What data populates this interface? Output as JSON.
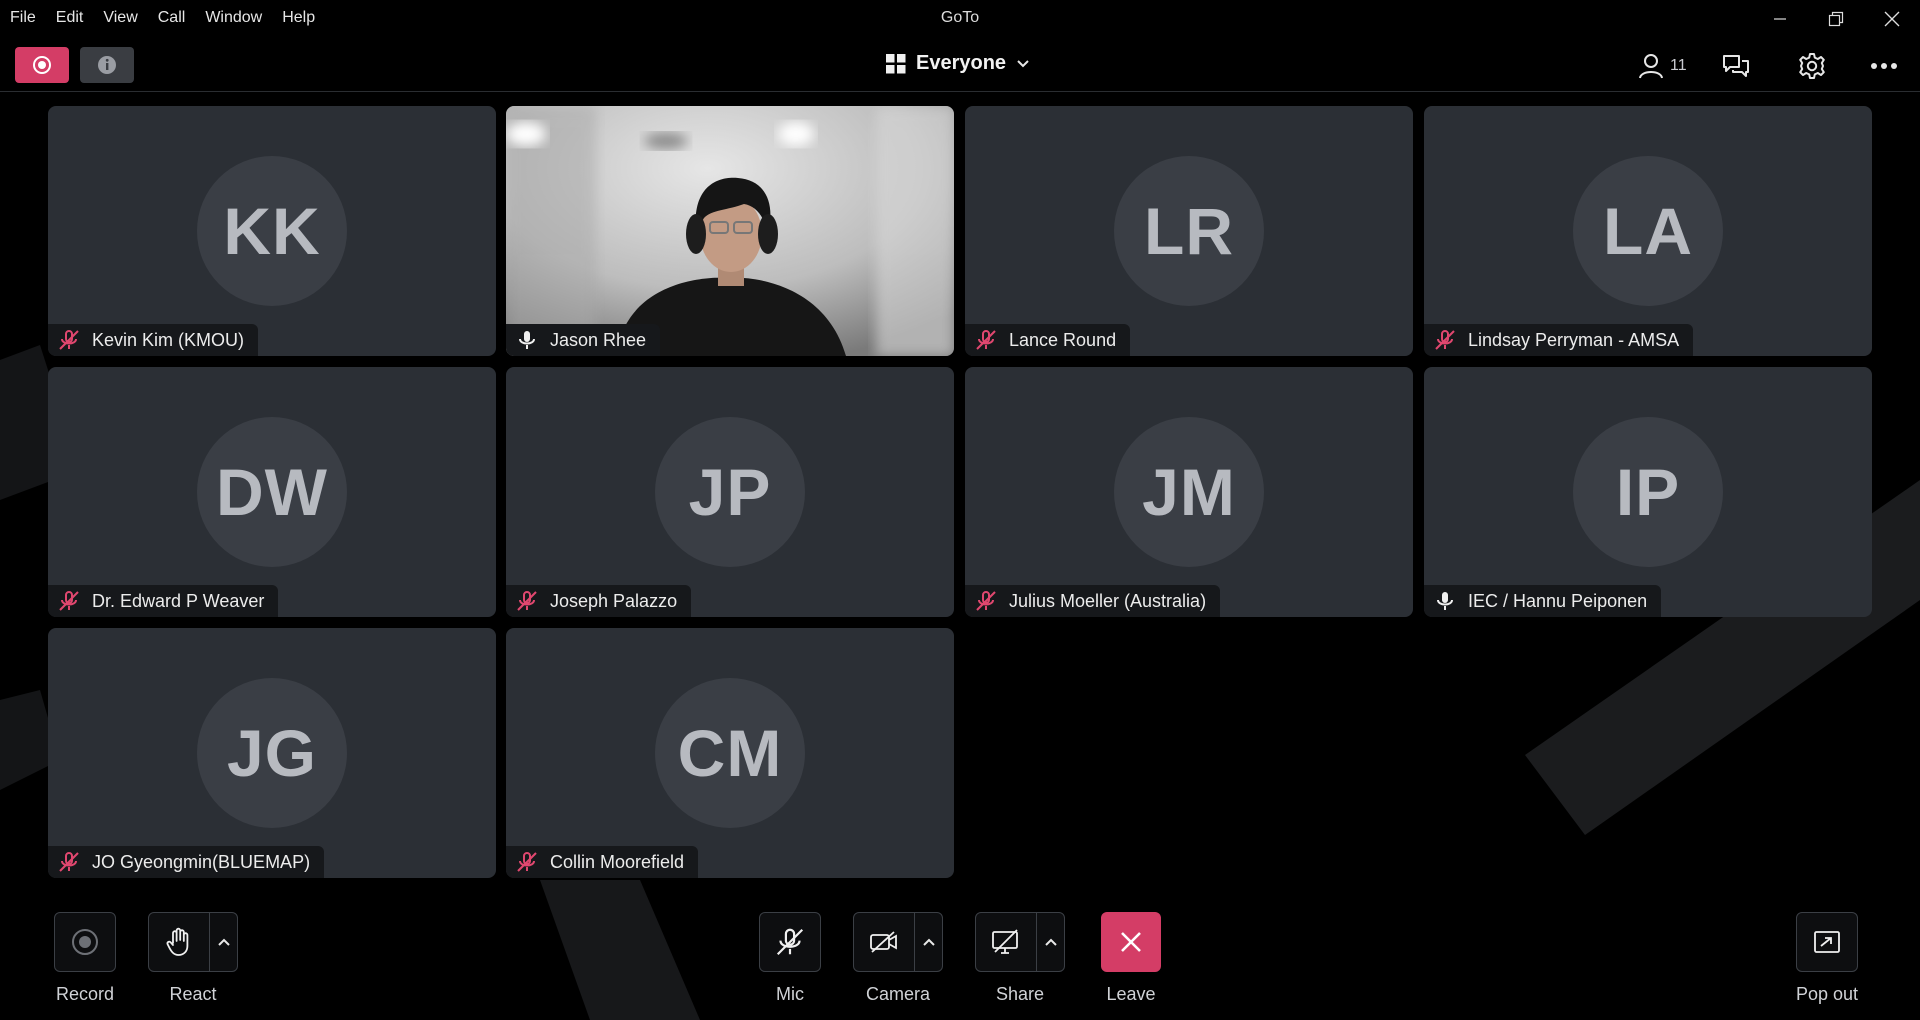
{
  "window": {
    "title": "GoTo"
  },
  "menu": [
    "File",
    "Edit",
    "View",
    "Call",
    "Window",
    "Help"
  ],
  "toolbar": {
    "view_label": "Everyone",
    "participant_count": "11"
  },
  "participants": [
    {
      "initials": "KK",
      "name": "Kevin Kim (KMOU)",
      "muted": true,
      "video": false
    },
    {
      "initials": "",
      "name": "Jason Rhee",
      "muted": false,
      "video": true
    },
    {
      "initials": "LR",
      "name": "Lance Round",
      "muted": true,
      "video": false
    },
    {
      "initials": "LA",
      "name": "Lindsay Perryman - AMSA",
      "muted": true,
      "video": false
    },
    {
      "initials": "DW",
      "name": "Dr. Edward P Weaver",
      "muted": true,
      "video": false
    },
    {
      "initials": "JP",
      "name": "Joseph Palazzo",
      "muted": true,
      "video": false
    },
    {
      "initials": "JM",
      "name": "Julius Moeller (Australia)",
      "muted": true,
      "video": false
    },
    {
      "initials": "IP",
      "name": "IEC / Hannu Peiponen",
      "muted": false,
      "video": false
    },
    {
      "initials": "JG",
      "name": "JO Gyeongmin(BLUEMAP)",
      "muted": true,
      "video": false
    },
    {
      "initials": "CM",
      "name": "Collin Moorefield",
      "muted": true,
      "video": false
    }
  ],
  "controls": {
    "record": "Record",
    "react": "React",
    "mic": "Mic",
    "camera": "Camera",
    "share": "Share",
    "leave": "Leave",
    "popout": "Pop out"
  },
  "colors": {
    "accent": "#d43d66",
    "tile": "#2b2f35",
    "avatar": "#3a3e45",
    "muted_icon": "#e0476f"
  }
}
